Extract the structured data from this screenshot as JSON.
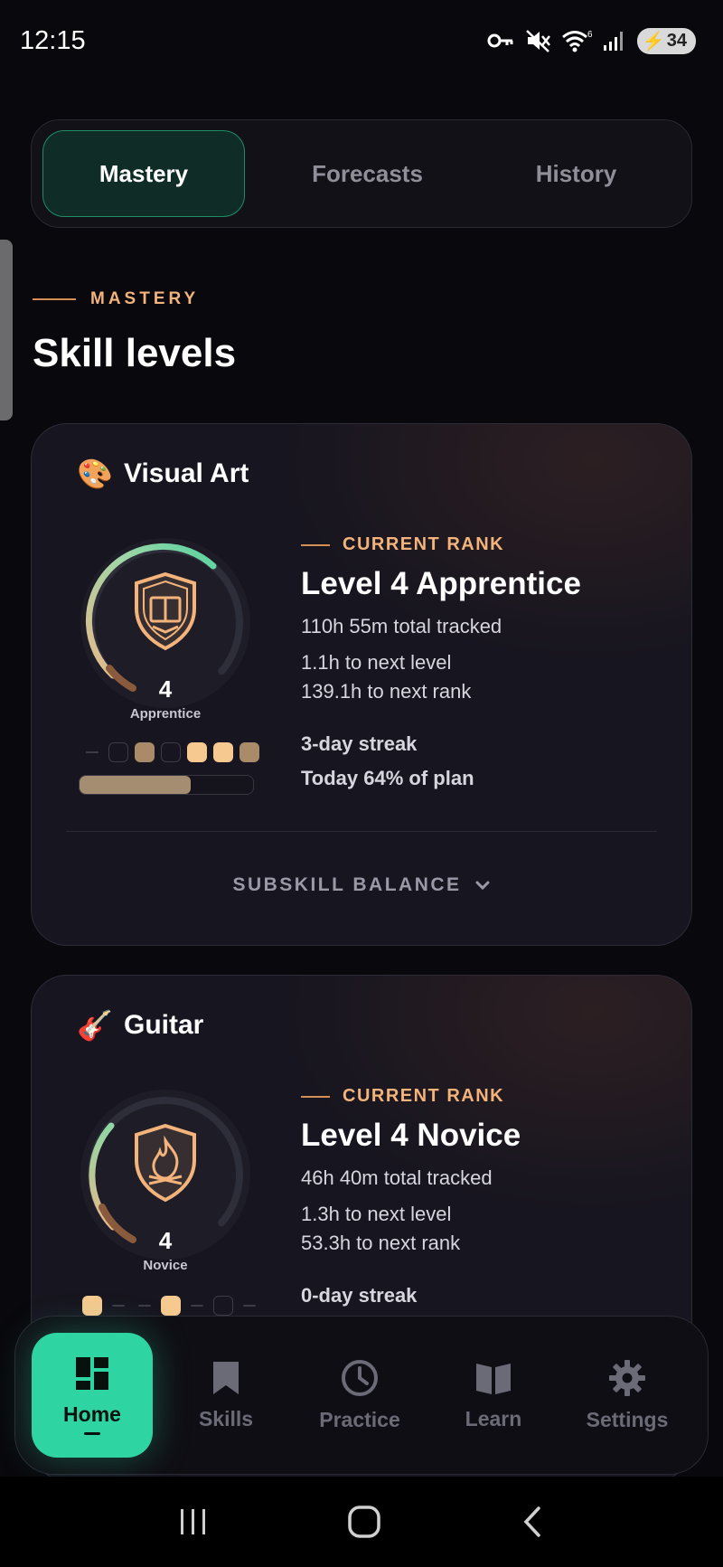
{
  "status_bar": {
    "time": "12:15",
    "battery": "34",
    "signal_badge": "6"
  },
  "tabs": [
    {
      "label": "Mastery",
      "active": true
    },
    {
      "label": "Forecasts",
      "active": false
    },
    {
      "label": "History",
      "active": false
    }
  ],
  "section": {
    "eyebrow": "MASTERY",
    "title": "Skill levels"
  },
  "skills": [
    {
      "emoji": "🎨",
      "name": "Visual Art",
      "level": "4",
      "rank": "Apprentice",
      "ring_progress": 0.64,
      "rank_label": "CURRENT RANK",
      "rank_title": "Level 4 Apprentice",
      "total": "110h 55m total tracked",
      "next_level": "1.1h to next level",
      "next_rank": "139.1h to next rank",
      "streak": "3-day streak",
      "plan": "Today 64% of plan",
      "plan_progress": 0.64,
      "balance_label": "SUBSKILL BALANCE"
    },
    {
      "emoji": "🎸",
      "name": "Guitar",
      "level": "4",
      "rank": "Novice",
      "ring_progress": 0.3,
      "rank_label": "CURRENT RANK",
      "rank_title": "Level 4 Novice",
      "total": "46h 40m total tracked",
      "next_level": "1.3h to next level",
      "next_rank": "53.3h to next rank",
      "streak": "0-day streak"
    }
  ],
  "nav": [
    {
      "label": "Home",
      "icon": "dashboard-icon",
      "active": true
    },
    {
      "label": "Skills",
      "icon": "bookmark-icon",
      "active": false
    },
    {
      "label": "Practice",
      "icon": "clock-icon",
      "active": false
    },
    {
      "label": "Learn",
      "icon": "book-icon",
      "active": false
    },
    {
      "label": "Settings",
      "icon": "gear-icon",
      "active": false
    }
  ],
  "colors": {
    "accent": "#2fd4a3",
    "rank_gold": "#f3b37b",
    "background": "#09080c",
    "card": "#17151f"
  }
}
